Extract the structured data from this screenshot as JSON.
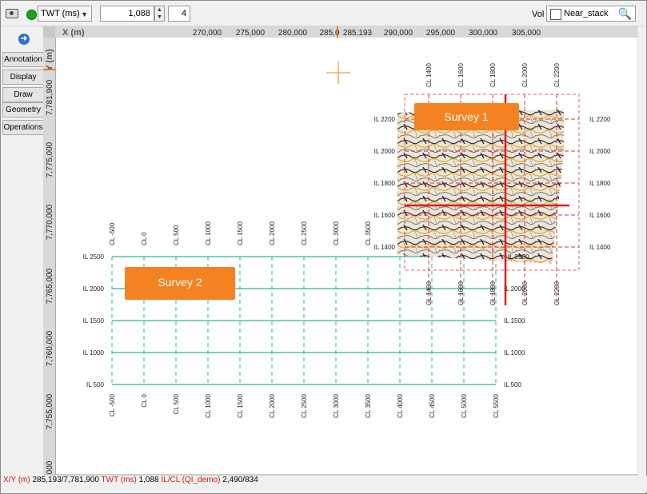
{
  "toolbar": {
    "domain_select": "TWT (ms)",
    "time_value": "1,088",
    "step_value": "4",
    "vol_label": "Vol",
    "vol_value": "Near_stack"
  },
  "side_tabs": [
    "Annotation",
    "Display",
    "Draw",
    "Geometry",
    "Operations"
  ],
  "rulers": {
    "x_title": "X (m)",
    "y_title": "Y (m)",
    "x_ticks": [
      "270,000",
      "275,000",
      "280,000",
      "285,0",
      "290,000",
      "295,000",
      "300,000",
      "305,000"
    ],
    "x_cursor": "285,193",
    "y_ticks": [
      "7,781,900",
      "7,775,000",
      "7,770,000",
      "7,765,000",
      "7,760,000",
      "7,755,000",
      "000"
    ]
  },
  "survey1": {
    "label": "Survey 1",
    "il_labels": [
      "IL 2200",
      "IL 2000",
      "IL 1800",
      "IL 1600",
      "IL 1400"
    ],
    "cl_labels": [
      "CL 1400",
      "CL 1600",
      "CL 1800",
      "CL 2000",
      "CL 2200"
    ],
    "inner_label": "IL 2500"
  },
  "survey2": {
    "label": "Survey 2",
    "il_labels": [
      "IL 2500",
      "IL 2000",
      "IL 1500",
      "IL 1000",
      "IL 500"
    ],
    "cl_labels": [
      "CL -500",
      "CL 0",
      "CL 500",
      "CL 1000",
      "CL 1500",
      "CL 2000",
      "CL 2500",
      "CL 3000",
      "CL 3500",
      "CL 4000",
      "CL 4500",
      "CL 5000",
      "CL 5500"
    ]
  },
  "status": {
    "xy_label": "X/Y (m)",
    "xy_value": "285,193/7,781,900",
    "twt_label": "TWT (ms)",
    "twt_value": "1,088",
    "ilcl_label": "IL/CL (QI_demo)",
    "ilcl_value": "2,490/834"
  },
  "colors": {
    "survey2_grid": "#2bb68f",
    "survey1_grid": "#d93030",
    "label_box": "#f58220",
    "cursor": "#f0a040"
  }
}
